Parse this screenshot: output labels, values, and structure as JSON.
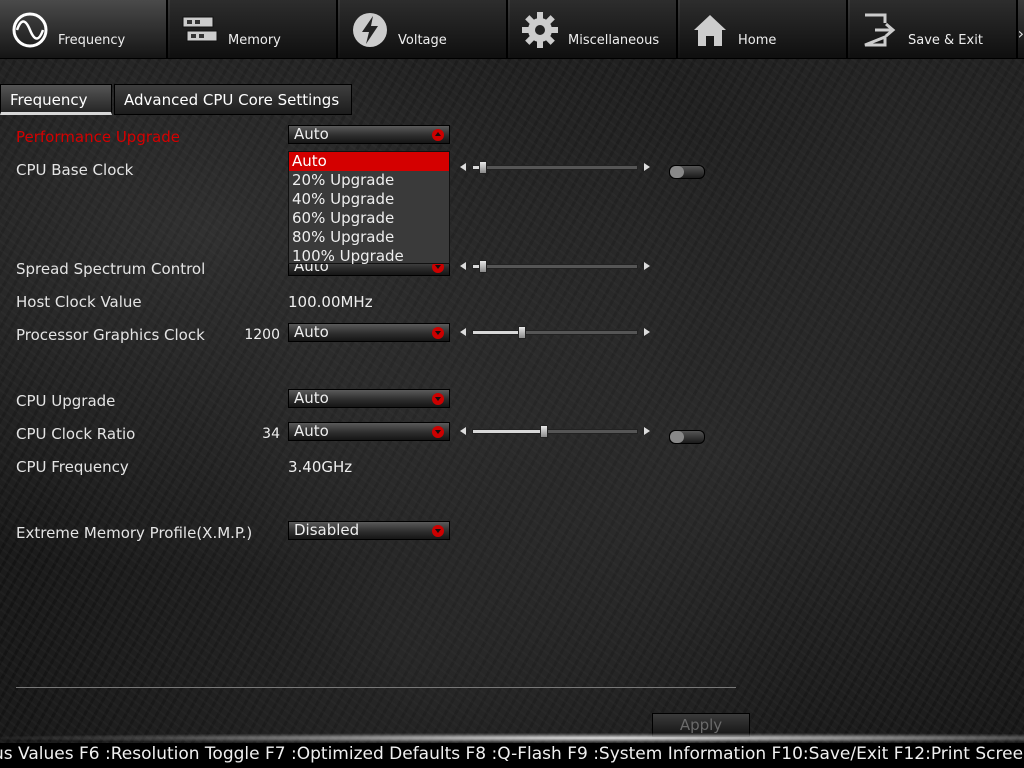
{
  "topnav": {
    "tabs": [
      {
        "label": "Frequency",
        "icon": "frequency-icon",
        "active": true
      },
      {
        "label": "Memory",
        "icon": "memory-icon"
      },
      {
        "label": "Voltage",
        "icon": "voltage-icon"
      },
      {
        "label": "Miscellaneous",
        "icon": "gear-icon"
      },
      {
        "label": "Home",
        "icon": "home-icon"
      },
      {
        "label": "Save & Exit",
        "icon": "exit-icon"
      }
    ],
    "more": "›"
  },
  "subtabs": {
    "frequency": "Frequency",
    "advanced": "Advanced CPU Core Settings"
  },
  "settings": {
    "performance_upgrade": {
      "label": "Performance Upgrade",
      "value": "Auto"
    },
    "cpu_base_clock": {
      "label": "CPU Base Clock",
      "slider_percent": 6
    },
    "spread_spectrum": {
      "label": "Spread Spectrum Control",
      "value": "Auto",
      "slider_percent": 6
    },
    "host_clock": {
      "label": "Host Clock Value",
      "value": "100.00MHz"
    },
    "processor_graphics_clock": {
      "label": "Processor Graphics Clock",
      "number": "1200",
      "value": "Auto",
      "slider_percent": 30
    },
    "cpu_upgrade": {
      "label": "CPU Upgrade",
      "value": "Auto"
    },
    "cpu_clock_ratio": {
      "label": "CPU Clock Ratio",
      "number": "34",
      "value": "Auto",
      "slider_percent": 43
    },
    "cpu_frequency": {
      "label": "CPU Frequency",
      "value": "3.40GHz"
    },
    "xmp": {
      "label": "Extreme Memory Profile(X.M.P.)",
      "value": "Disabled"
    }
  },
  "performance_options": [
    "Auto",
    "20% Upgrade",
    "40% Upgrade",
    "60% Upgrade",
    "80% Upgrade",
    "100% Upgrade"
  ],
  "selected_option": "Auto",
  "apply_label": "Apply",
  "status_bar": "us Values F6 :Resolution Toggle F7 :Optimized Defaults F8 :Q-Flash F9 :System Information F10:Save/Exit F12:Print Scree",
  "colors": {
    "accent": "#d40000"
  }
}
